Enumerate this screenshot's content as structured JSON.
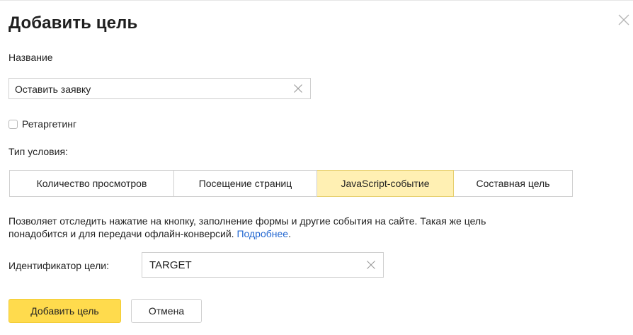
{
  "dialog": {
    "title": "Добавить цель",
    "close_icon": "close-icon"
  },
  "name_field": {
    "label": "Название",
    "value": "Оставить заявку",
    "clear_icon": "clear-icon"
  },
  "retargeting": {
    "label": "Ретаргетинг",
    "checked": false
  },
  "condition": {
    "label": "Тип условия:",
    "tabs": [
      {
        "label": "Количество просмотров",
        "active": false
      },
      {
        "label": "Посещение страниц",
        "active": false
      },
      {
        "label": "JavaScript-событие",
        "active": true
      },
      {
        "label": "Составная цель",
        "active": false
      }
    ]
  },
  "description": {
    "line1": "Позволяет отследить нажатие на кнопку, заполнение формы и другие события на сайте. Такая же цель",
    "line2": "понадобится и для передачи офлайн-конверсий. ",
    "link": "Подробнее",
    "link_suffix": "."
  },
  "identifier": {
    "label": "Идентификатор цели:",
    "value": "TARGET",
    "clear_icon": "clear-icon"
  },
  "actions": {
    "submit_label": "Добавить цель",
    "cancel_label": "Отмена"
  },
  "colors": {
    "primary_button": "#ffdb4d",
    "active_tab": "#fff0b3",
    "link": "#2468d1"
  }
}
